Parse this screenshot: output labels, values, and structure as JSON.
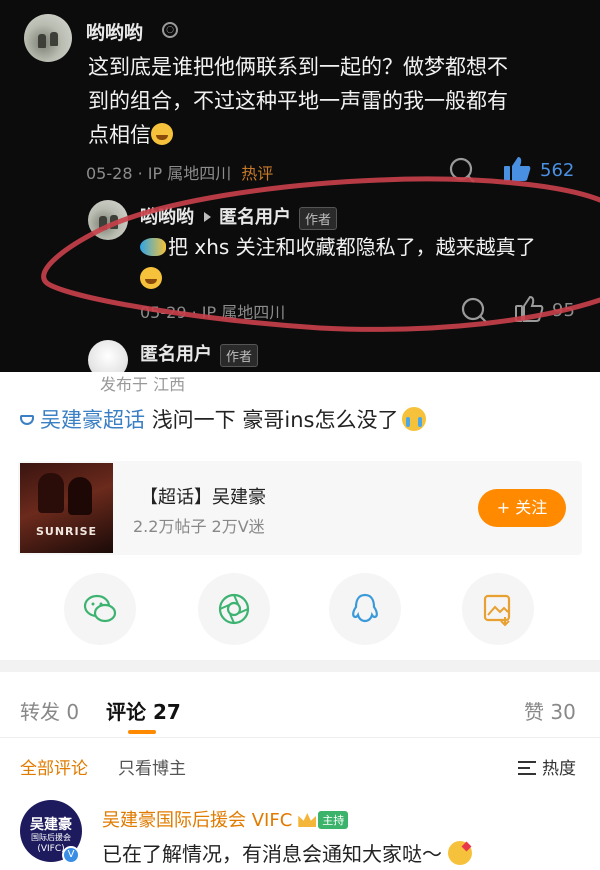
{
  "top_comment": {
    "username": "哟哟哟",
    "text_line1": "这到底是谁把他俩联系到一起的？做梦都想不",
    "text_line2": "到的组合，不过这种平地一声雷的我一般都有",
    "text_line3": "点相信",
    "date_ip": "05-28 · IP 属地四川",
    "hot_label": "热评",
    "like_count": "562"
  },
  "reply": {
    "username": "哟哟哟",
    "reply_to": "匿名用户",
    "author_tag": "作者",
    "text": "把 xhs 关注和收藏都隐私了，越来越真了",
    "date_ip": "05-29 · IP 属地四川",
    "like_count": "95"
  },
  "anon": {
    "username": "匿名用户",
    "author_tag": "作者",
    "location": "发布于 江西"
  },
  "post": {
    "topic": "吴建豪超话",
    "text": "浅问一下 豪哥ins怎么没了"
  },
  "supertopic_card": {
    "cover_text": "SUNRISE",
    "title": "【超话】吴建豪",
    "stats": "2.2万帖子 2万V迷",
    "follow_label": "+ 关注"
  },
  "share": [
    "wechat-icon",
    "moments-icon",
    "qq-icon",
    "save-image-icon"
  ],
  "tabs": {
    "repost": "转发 0",
    "comments": "评论 27",
    "likes": "赞 30"
  },
  "subtabs": {
    "all": "全部评论",
    "op_only": "只看博主",
    "sort": "热度"
  },
  "comment": {
    "avatar_line1": "吴建豪",
    "avatar_line2": "国际后援会",
    "avatar_line3": "(VIFC)",
    "username": "吴建豪国际后援会 VIFC",
    "host_tag": "主持",
    "text": "已在了解情况，有消息会通知大家哒～"
  },
  "colors": {
    "accent_orange": "#ff8a00",
    "link_blue": "#3b7fc4",
    "like_blue": "#4a90e2",
    "annotation_red": "#c9404a"
  }
}
